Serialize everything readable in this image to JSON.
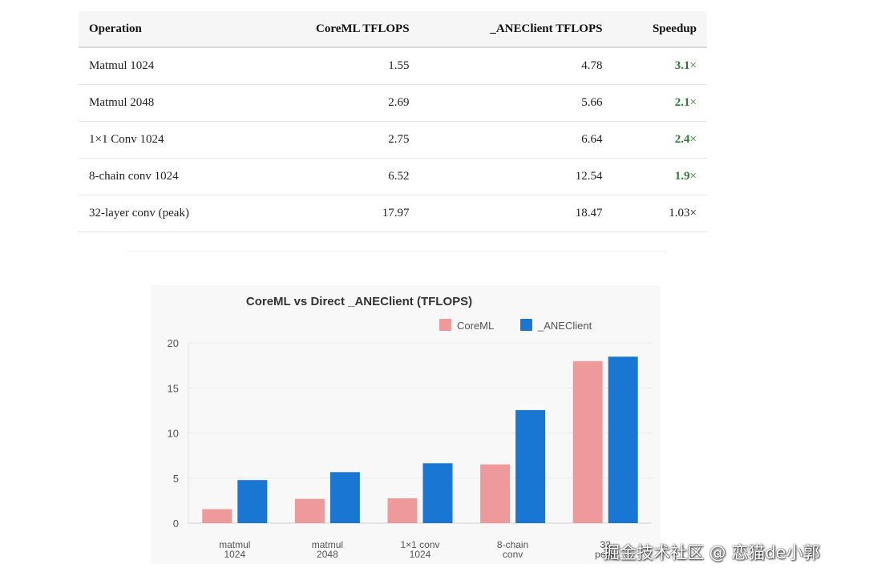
{
  "table": {
    "headers": [
      "Operation",
      "CoreML TFLOPS",
      "_ANEClient TFLOPS",
      "Speedup"
    ],
    "rows": [
      {
        "operation": "Matmul 1024",
        "coreml": "1.55",
        "ane": "4.78",
        "speedup": "3.1",
        "suffix": "×",
        "highlight": true
      },
      {
        "operation": "Matmul 2048",
        "coreml": "2.69",
        "ane": "5.66",
        "speedup": "2.1",
        "suffix": "×",
        "highlight": true
      },
      {
        "operation": "1×1 Conv 1024",
        "coreml": "2.75",
        "ane": "6.64",
        "speedup": "2.4",
        "suffix": "×",
        "highlight": true
      },
      {
        "operation": "8-chain conv 1024",
        "coreml": "6.52",
        "ane": "12.54",
        "speedup": "1.9",
        "suffix": "×",
        "highlight": true
      },
      {
        "operation": "32-layer conv (peak)",
        "coreml": "17.97",
        "ane": "18.47",
        "speedup": "1.03",
        "suffix": "×",
        "highlight": false
      }
    ]
  },
  "chart_data": {
    "type": "bar",
    "title": "CoreML vs Direct _ANEClient (TFLOPS)",
    "categories": [
      [
        "matmul",
        "1024"
      ],
      [
        "matmul",
        "2048"
      ],
      [
        "1×1 conv",
        "1024"
      ],
      [
        "8-chain",
        "conv"
      ],
      [
        "32",
        "peak"
      ]
    ],
    "series": [
      {
        "name": "CoreML",
        "color": "#ef9a9a",
        "values": [
          1.55,
          2.69,
          2.75,
          6.52,
          17.97
        ]
      },
      {
        "name": "_ANEClient",
        "color": "#1976d2",
        "values": [
          4.78,
          5.66,
          6.64,
          12.54,
          18.47
        ]
      }
    ],
    "xlabel": "",
    "ylabel": "",
    "ylim": [
      0,
      20
    ],
    "yticks": [
      "0",
      "5",
      "10",
      "15",
      "20"
    ],
    "grid": true,
    "legend": "top-right"
  },
  "watermark": "掘金技术社区 @ 恋猫de小郭"
}
